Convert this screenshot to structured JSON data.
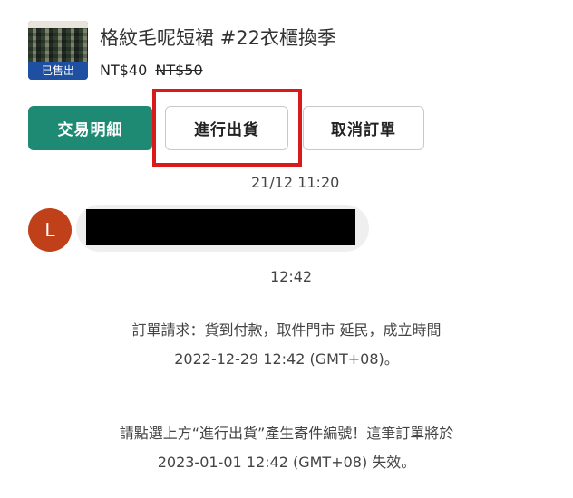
{
  "product": {
    "title": "格紋毛呢短裙 #22衣櫃換季",
    "sold_badge": "已售出",
    "price_now": "NT$40",
    "price_old": "NT$50"
  },
  "actions": {
    "detail_label": "交易明細",
    "ship_label": "進行出貨",
    "cancel_label": "取消訂單"
  },
  "chat": {
    "timestamp_1": "21/12 11:20",
    "avatar_letter": "L",
    "timestamp_2": "12:42"
  },
  "system_messages": {
    "order_line1": "訂單請求：貨到付款，取件門市 延民，成立時間",
    "order_line2": "2022-12-29 12:42 (GMT+08)。",
    "reminder_line1": "請點選上方“進行出貨”產生寄件編號！這筆訂單將於",
    "reminder_line2": "2023-01-01 12:42 (GMT+08) 失效。"
  },
  "colors": {
    "primary_green": "#1e8a73",
    "sold_badge_blue": "#1f4fa0",
    "avatar_orange": "#c0401a",
    "highlight_red": "#d81a1a"
  }
}
